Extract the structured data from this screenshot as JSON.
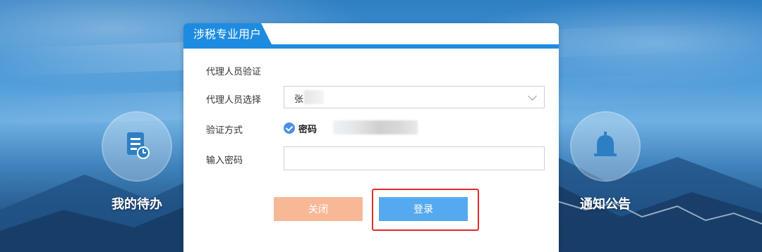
{
  "background": {
    "tiles": [
      {
        "label": "我的待办",
        "icon": "document-clock-icon"
      },
      {
        "label": "通知公告",
        "icon": "bell-icon"
      }
    ]
  },
  "dialog": {
    "tab_title": "涉税专业用户",
    "section_title": "代理人员验证",
    "agent_select": {
      "label": "代理人员选择",
      "value": "张"
    },
    "auth_method": {
      "label": "验证方式",
      "option": "密码",
      "checked": true
    },
    "password": {
      "label": "输入密码",
      "value": ""
    },
    "buttons": {
      "close": "关闭",
      "login": "登录"
    }
  },
  "colors": {
    "primary": "#1d8ce0",
    "close_button": "#f7b896",
    "login_button": "#55a9ee",
    "highlight": "#e02c2c"
  }
}
